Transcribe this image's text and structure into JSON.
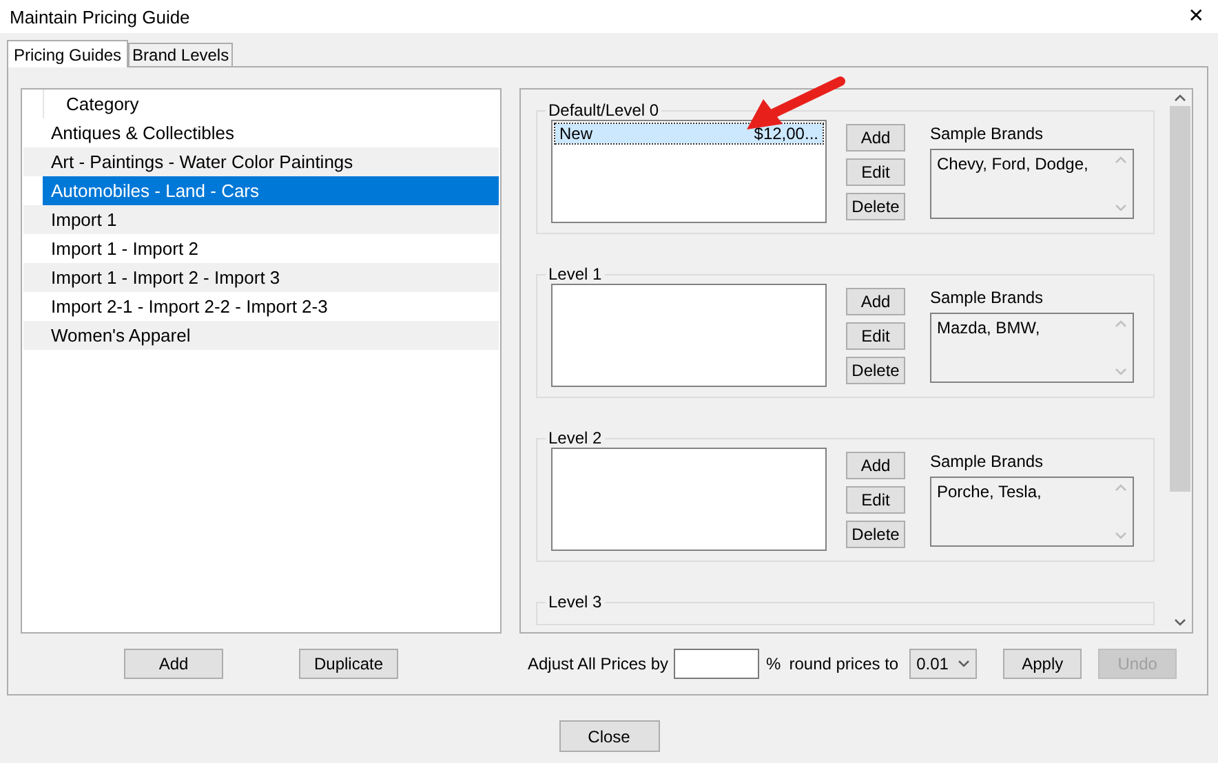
{
  "window": {
    "title": "Maintain Pricing Guide",
    "close_glyph": "✕"
  },
  "tabs": [
    {
      "label": "Pricing Guides",
      "selected": true
    },
    {
      "label": "Brand Levels",
      "selected": false
    }
  ],
  "category_list": {
    "header": "Category",
    "items": [
      {
        "label": "Antiques & Collectibles",
        "selected": false
      },
      {
        "label": "Art - Paintings - Water Color Paintings",
        "selected": false
      },
      {
        "label": "Automobiles - Land - Cars",
        "selected": true
      },
      {
        "label": "Import 1",
        "selected": false
      },
      {
        "label": "Import 1 - Import 2",
        "selected": false
      },
      {
        "label": "Import 1 - Import 2 - Import 3",
        "selected": false
      },
      {
        "label": "Import 2-1 - Import 2-2 - Import 2-3",
        "selected": false
      },
      {
        "label": "Women's Apparel",
        "selected": false
      }
    ]
  },
  "levels": [
    {
      "title": "Default/Level 0",
      "entries": [
        {
          "name": "New",
          "price": "$12,00...",
          "selected": true
        }
      ],
      "buttons": [
        "Add",
        "Edit",
        "Delete"
      ],
      "sample_brands_label": "Sample Brands",
      "sample_brands": "Chevy,  Ford,  Dodge,"
    },
    {
      "title": "Level 1",
      "buttons": [
        "Add",
        "Edit",
        "Delete"
      ],
      "sample_brands_label": "Sample Brands",
      "sample_brands": "Mazda,  BMW,"
    },
    {
      "title": "Level 2",
      "buttons": [
        "Add",
        "Edit",
        "Delete"
      ],
      "sample_brands_label": "Sample Brands",
      "sample_brands": "Porche,  Tesla,"
    },
    {
      "title": "Level 3"
    }
  ],
  "list_buttons": [
    "Add",
    "Duplicate"
  ],
  "adjust": {
    "label": "Adjust All Prices by",
    "percent": "%",
    "round_label": "round prices to",
    "round_value": "0.01",
    "buttons": [
      {
        "label": "Apply",
        "disabled": false
      },
      {
        "label": "Undo",
        "disabled": true
      }
    ]
  },
  "close_button": "Close"
}
